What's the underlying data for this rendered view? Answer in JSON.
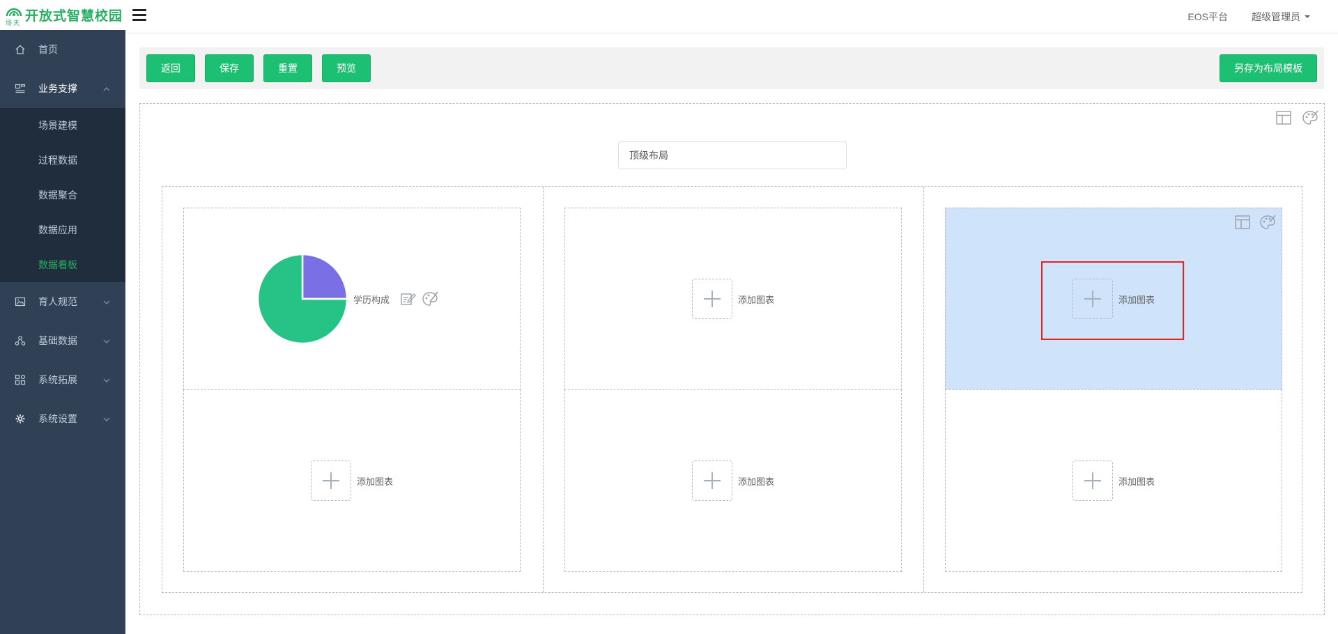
{
  "app": {
    "title": "开放式智慧校园"
  },
  "sidebar": {
    "items": [
      {
        "label": "首页",
        "icon": "home-icon"
      },
      {
        "label": "业务支撑",
        "icon": "dashboard-icon",
        "expanded": true,
        "children": [
          "场景建模",
          "过程数据",
          "数据聚合",
          "数据应用",
          "数据看板"
        ],
        "active_child": "数据看板"
      },
      {
        "label": "育人规范",
        "icon": "image-icon"
      },
      {
        "label": "基础数据",
        "icon": "nodes-icon"
      },
      {
        "label": "系统拓展",
        "icon": "grid-icon"
      },
      {
        "label": "系统设置",
        "icon": "settings-icon"
      }
    ]
  },
  "navbar": {
    "platform_link": "EOS平台",
    "user_name": "超级管理员"
  },
  "toolbar": {
    "back_label": "返回",
    "save_label": "保存",
    "reset_label": "重置",
    "preview_label": "预览",
    "save_template_label": "另存为布局模板"
  },
  "layout": {
    "title_value": "顶级布局",
    "add_chart_label": "添加图表",
    "chart_title": "学历构成"
  },
  "chart_data": {
    "type": "pie",
    "categories": [
      "",
      ""
    ],
    "values": [
      25,
      75
    ],
    "colors": [
      "#7b6fe6",
      "#27c386"
    ]
  },
  "colors": {
    "accent": "#1dbf73",
    "sidebar_bg": "#304156",
    "submenu_bg": "#1f2d3d",
    "selected_cell": "#cfe3fb",
    "highlight_border": "#e8231b"
  }
}
